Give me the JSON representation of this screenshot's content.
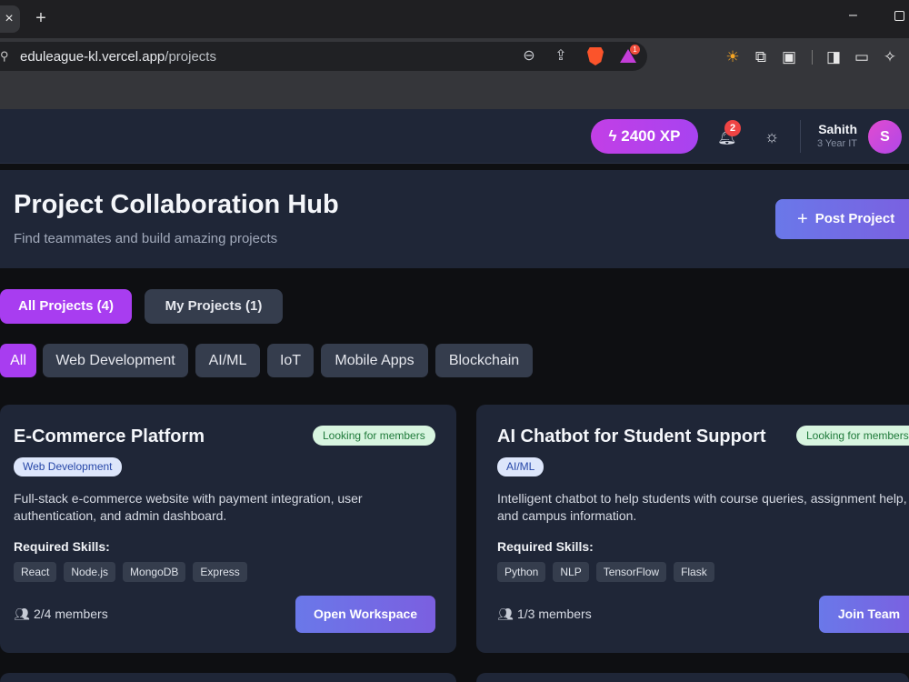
{
  "browser": {
    "tab_close": "×",
    "new_tab": "+",
    "url_domain": "eduleague-kl.vercel.app",
    "url_path": "/projects",
    "extension_badge": "1",
    "minimize": "–"
  },
  "header": {
    "xp_label": "2400 XP",
    "notifications_count": "2",
    "user_name": "Sahith",
    "user_year": "3 Year IT",
    "avatar_initial": "S"
  },
  "hero": {
    "title": "Project Collaboration Hub",
    "subtitle": "Find teammates and build amazing projects",
    "post_button": "Post Project"
  },
  "tabs": [
    {
      "label": "All Projects (4)",
      "active": true
    },
    {
      "label": "My Projects (1)",
      "active": false
    }
  ],
  "categories": [
    {
      "label": "All",
      "active": true
    },
    {
      "label": "Web Development",
      "active": false
    },
    {
      "label": "AI/ML",
      "active": false
    },
    {
      "label": "IoT",
      "active": false
    },
    {
      "label": "Mobile Apps",
      "active": false
    },
    {
      "label": "Blockchain",
      "active": false
    }
  ],
  "projects": [
    {
      "title": "E-Commerce Platform",
      "status": "Looking for members",
      "category": "Web Development",
      "description": "Full-stack e-commerce website with payment integration, user authentication, and admin dashboard.",
      "skills_label": "Required Skills:",
      "skills": [
        "React",
        "Node.js",
        "MongoDB",
        "Express"
      ],
      "members": "2/4 members",
      "action": "Open Workspace"
    },
    {
      "title": "AI Chatbot for Student Support",
      "status": "Looking for members",
      "category": "AI/ML",
      "description": "Intelligent chatbot to help students with course queries, assignment help, and campus information.",
      "skills_label": "Required Skills:",
      "skills": [
        "Python",
        "NLP",
        "TensorFlow",
        "Flask"
      ],
      "members": "1/3 members",
      "action": "Join Team"
    }
  ],
  "colors": {
    "accent_purple": "#a83df0",
    "gradient_button": "#6a78e9",
    "card_bg": "#1f2637",
    "status_green_bg": "#d8f5e0"
  }
}
